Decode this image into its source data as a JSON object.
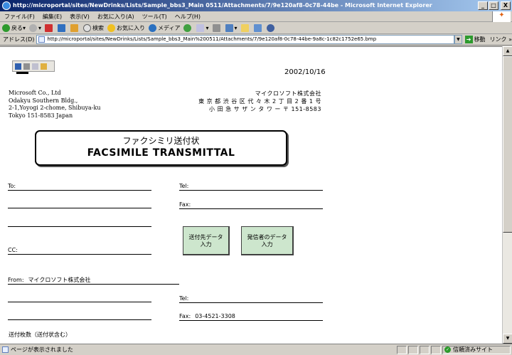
{
  "window": {
    "title": "http://microportal/sites/NewDrinks/Lists/Sample_bbs3_Main 0511/Attachments/7/9e120af8-0c78-44be - Microsoft Internet Explorer",
    "minimize": "_",
    "maximize": "□",
    "close": "X"
  },
  "menubar": {
    "items": [
      "ファイル(F)",
      "編集(E)",
      "表示(V)",
      "お気に入り(A)",
      "ツール(T)",
      "ヘルプ(H)"
    ]
  },
  "toolbar": {
    "back": "戻る",
    "search": "検索",
    "favorites": "お気に入り",
    "media": "メディア"
  },
  "addressbar": {
    "label": "アドレス(D)",
    "url": "http://microportal/sites/NewDrinks/Lists/Sample_bbs3_Main%200511/Attachments/7/9e120af8-0c78-44be-9a8c-1c82c1752e65.bmp",
    "go": "移動",
    "links": "リンク"
  },
  "status": {
    "text": "ページが表示されました",
    "zone": "信頼済みサイト"
  },
  "fax": {
    "date": "2002/10/16",
    "addr_en": [
      "Microsoft Co., Ltd",
      "Odakyu Southern Bldg.,",
      "2-1,Yoyogi 2-chome, Shibuya-ku",
      "Tokyo 151-8583 Japan"
    ],
    "addr_jp": [
      "マイクロソフト株式会社",
      "東 京 都 渋 谷 区 代 々 木 2 丁 目 2 番 1 号",
      "小 田 急 サ ザ ン タ ワ ー 〒 151-8583"
    ],
    "title_jp": "ファクシミリ送付状",
    "title_en": "FACSIMILE  TRANSMITTAL",
    "to_label": "To:",
    "tel_label": "Tel:",
    "fax_label": "Fax:",
    "cc_label": "CC:",
    "btn_recipient": "送付先データ\n入力",
    "btn_sender": "発信者のデータ\n入力",
    "from_label": "From:",
    "from_value": "マイクロソフト株式会社",
    "from_tel_label": "Tel:",
    "from_fax_label": "Fax:",
    "from_fax_value": "03-4521-3308",
    "pages_label": "送付枚数（送付状含む）"
  }
}
